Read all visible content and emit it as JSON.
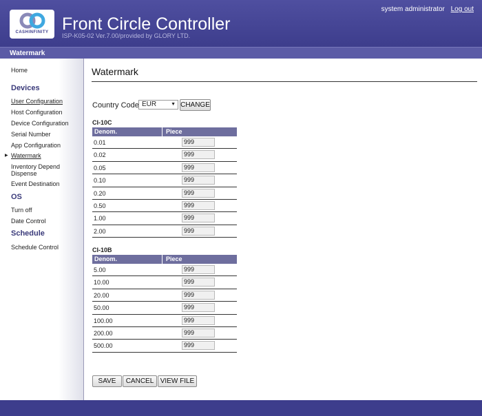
{
  "header": {
    "logo_text": "CASHINFINITY",
    "title": "Front Circle Controller",
    "subtitle": "ISP-K05-02 Ver.7.00/provided by GLORY LTD.",
    "user": "system administrator",
    "logout": "Log out"
  },
  "subbar": {
    "label": "Watermark"
  },
  "sidebar": {
    "home": "Home",
    "devices_heading": "Devices",
    "user_config": "User Configuration",
    "host_config": "Host Configuration",
    "device_config": "Device Configuration",
    "serial_number": "Serial Number",
    "app_config": "App Configuration",
    "watermark": "Watermark",
    "inventory_1": "Inventory Depend",
    "inventory_2": "Dispense",
    "event_destination": "Event Destination",
    "os_heading": "OS",
    "turn_off": "Turn off",
    "date_control": "Date Control",
    "schedule_heading": "Schedule",
    "schedule_control": "Schedule Control"
  },
  "main": {
    "title": "Watermark",
    "country_label": "Country Code:",
    "country_value": "EUR",
    "change_button": "CHANGE",
    "col_denom": "Denom.",
    "col_piece": "Piece",
    "ci10c": {
      "label": "CI-10C",
      "rows": [
        {
          "denom": "0.01",
          "piece": "999"
        },
        {
          "denom": "0.02",
          "piece": "999"
        },
        {
          "denom": "0.05",
          "piece": "999"
        },
        {
          "denom": "0.10",
          "piece": "999"
        },
        {
          "denom": "0.20",
          "piece": "999"
        },
        {
          "denom": "0.50",
          "piece": "999"
        },
        {
          "denom": "1.00",
          "piece": "999"
        },
        {
          "denom": "2.00",
          "piece": "999"
        }
      ]
    },
    "ci10b": {
      "label": "CI-10B",
      "rows": [
        {
          "denom": "5.00",
          "piece": "999"
        },
        {
          "denom": "10.00",
          "piece": "999"
        },
        {
          "denom": "20.00",
          "piece": "999"
        },
        {
          "denom": "50.00",
          "piece": "999"
        },
        {
          "denom": "100.00",
          "piece": "999"
        },
        {
          "denom": "200.00",
          "piece": "999"
        },
        {
          "denom": "500.00",
          "piece": "999"
        }
      ]
    },
    "save_button": "SAVE",
    "cancel_button": "CANCEL",
    "view_file_button": "VIEW FILE"
  },
  "colors": {
    "brand": "#3d3d8c",
    "table_header": "#6e6e9e"
  }
}
